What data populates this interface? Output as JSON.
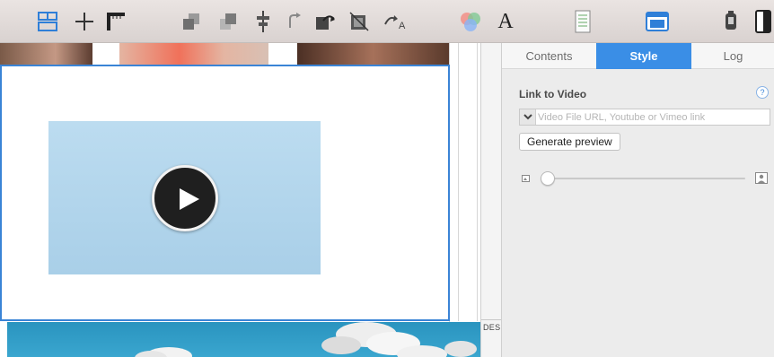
{
  "panel": {
    "tabs": [
      {
        "label": "Contents",
        "active": false
      },
      {
        "label": "Style",
        "active": true
      },
      {
        "label": "Log",
        "active": false
      }
    ],
    "section_title": "Link to Video",
    "help_label": "?",
    "url_placeholder": "Video File URL, Youtube or Vimeo link",
    "url_value": "",
    "generate_label": "Generate preview",
    "preview_size_fraction": 0.0
  },
  "canvas": {
    "gutter_label": "DES"
  },
  "toolbar": {
    "icons": [
      "layout-icon",
      "move-icon",
      "crop-corner-icon",
      "bring-forward-icon",
      "send-backward-icon",
      "align-icon",
      "rotate-icon",
      "flip-icon",
      "fill-icon",
      "text-path-icon",
      "colors-icon",
      "fonts-icon",
      "list-icon",
      "window-icon",
      "preview-icon",
      "split-icon"
    ],
    "fonts_glyph": "A"
  },
  "colors": {
    "accent": "#3a8ee6",
    "selection": "#3a84d6",
    "video_bg": "#bcdcf0"
  }
}
